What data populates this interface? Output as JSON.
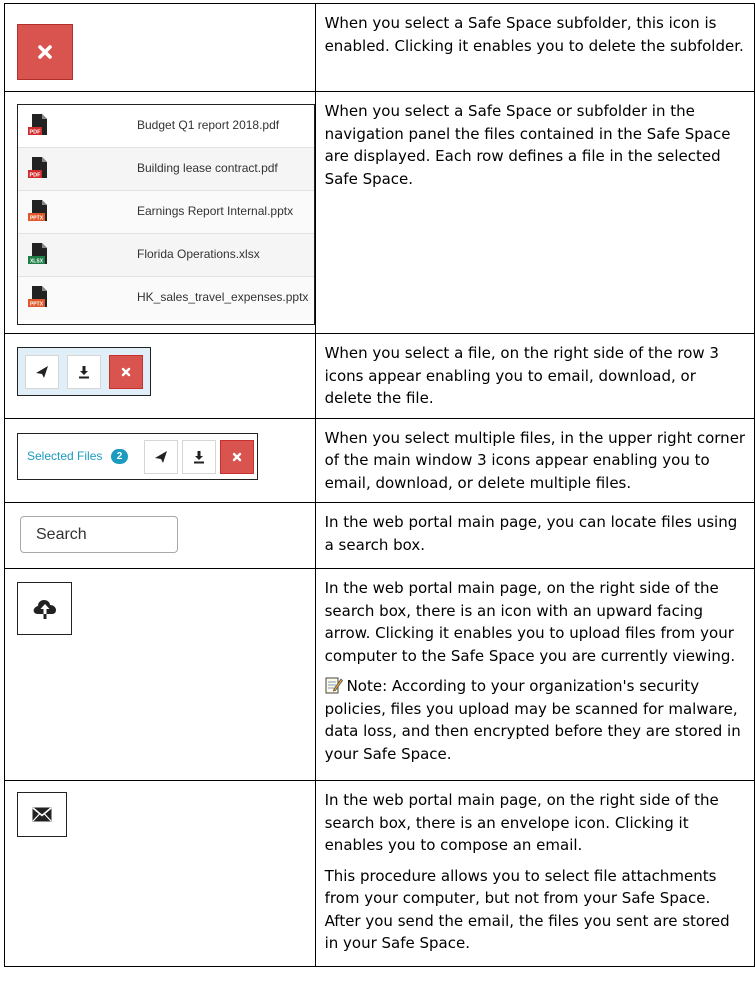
{
  "rows": [
    {
      "description": [
        "When you select a Safe Space subfolder, this icon is enabled. Clicking it enables you to delete the subfolder."
      ]
    },
    {
      "files": [
        {
          "name": "Budget Q1 report 2018.pdf",
          "type": "PDF",
          "color": "#d22b2b"
        },
        {
          "name": "Building lease contract.pdf",
          "type": "PDF",
          "color": "#d22b2b"
        },
        {
          "name": "Earnings Report Internal.pptx",
          "type": "PPTX",
          "color": "#e0592a"
        },
        {
          "name": "Florida Operations.xlsx",
          "type": "XLSX",
          "color": "#1e7e45"
        },
        {
          "name": "HK_sales_travel_expenses.pptx",
          "type": "PPTX",
          "color": "#e0592a"
        }
      ],
      "description": [
        "When you select a Safe Space or subfolder in the navigation panel the files contained in the Safe Space are displayed. Each row defines a file in the selected Safe Space."
      ]
    },
    {
      "description": [
        "When you select a file, on the right side of the row 3 icons appear enabling you to email, download, or delete the file."
      ]
    },
    {
      "selected_label": "Selected Files",
      "selected_count": "2",
      "description": [
        "When you select multiple files, in the upper right corner of the main window 3 icons appear enabling you to email, download, or delete multiple files."
      ]
    },
    {
      "search_value": "Search",
      "description": [
        "In the web portal main page, you can locate files using a search box."
      ]
    },
    {
      "description": [
        "In the web portal main page, on the right side of the search box, there is an icon with an upward facing arrow. Clicking it enables you to upload files from your computer to the Safe Space you are currently viewing."
      ],
      "note": "Note: According to your organization's security policies, files you upload may be scanned for malware, data loss, and then encrypted before they are stored in your Safe Space."
    },
    {
      "description": [
        "In the web portal main page, on the right side of the search box, there is an envelope icon. Clicking it enables you to compose an email.",
        "This procedure allows you to select file attachments from your computer, but not from your Safe Space. After you send the email, the files you sent are stored in your Safe Space."
      ]
    }
  ],
  "icons": {
    "delete": "close-icon",
    "email": "paper-plane-icon",
    "download": "download-icon",
    "upload": "cloud-upload-icon",
    "mail": "envelope-icon",
    "note": "notepad-pencil-icon"
  },
  "colors": {
    "danger": "#d9534f",
    "accent": "#1a9bbf",
    "action_bar_bg": "#dfeef7"
  }
}
